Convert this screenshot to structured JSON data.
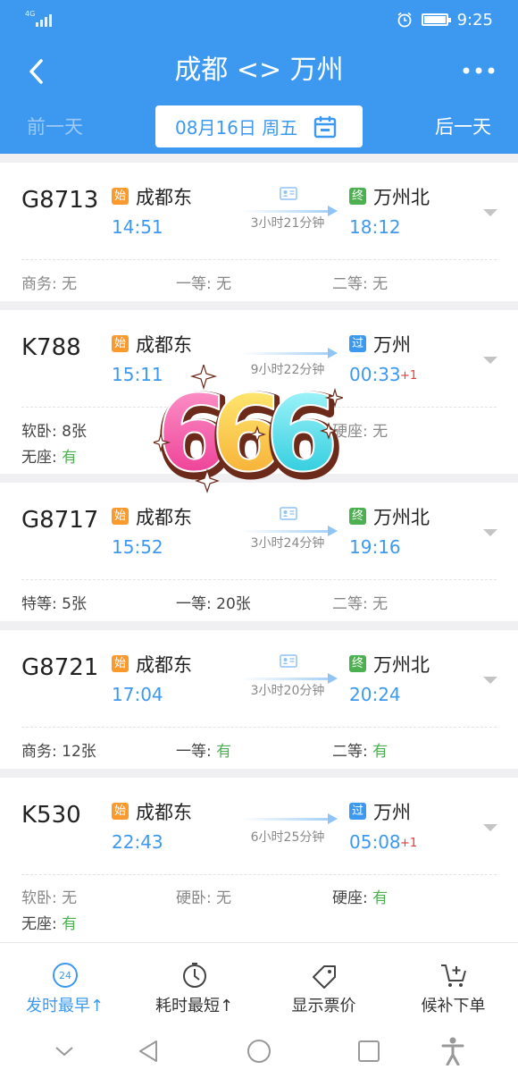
{
  "status_bar": {
    "network": "4G",
    "time": "9:25"
  },
  "header": {
    "title": "成都 <> 万州",
    "prev_day": "前一天",
    "date": "08月16日 周五",
    "next_day": "后一天"
  },
  "trains": [
    {
      "number": "G8713",
      "from_tag": "始",
      "from_station": "成都东",
      "depart": "14:51",
      "to_tag": "终",
      "to_station": "万州北",
      "arrive": "18:12",
      "next_day_mark": "",
      "duration": "3小时21分钟",
      "seats": [
        {
          "label": "商务: ",
          "value": "无"
        },
        {
          "label": "一等: ",
          "value": "无"
        },
        {
          "label": "二等: ",
          "value": "无"
        }
      ]
    },
    {
      "number": "K788",
      "from_tag": "始",
      "from_station": "成都东",
      "depart": "15:11",
      "to_tag": "过",
      "to_station": "万州",
      "arrive": "00:33",
      "next_day_mark": "+1",
      "duration": "9小时22分钟",
      "seats": [
        {
          "label": "软卧: ",
          "value": "8张"
        },
        {
          "label": "硬座: ",
          "value": "无"
        },
        {
          "label": "无座: ",
          "value": "有"
        }
      ]
    },
    {
      "number": "G8717",
      "from_tag": "始",
      "from_station": "成都东",
      "depart": "15:52",
      "to_tag": "终",
      "to_station": "万州北",
      "arrive": "19:16",
      "next_day_mark": "",
      "duration": "3小时24分钟",
      "seats": [
        {
          "label": "特等: ",
          "value": "5张"
        },
        {
          "label": "一等: ",
          "value": "20张"
        },
        {
          "label": "二等: ",
          "value": "无"
        }
      ]
    },
    {
      "number": "G8721",
      "from_tag": "始",
      "from_station": "成都东",
      "depart": "17:04",
      "to_tag": "终",
      "to_station": "万州北",
      "arrive": "20:24",
      "next_day_mark": "",
      "duration": "3小时20分钟",
      "seats": [
        {
          "label": "商务: ",
          "value": "12张"
        },
        {
          "label": "一等: ",
          "value": "有"
        },
        {
          "label": "二等: ",
          "value": "有"
        }
      ]
    },
    {
      "number": "K530",
      "from_tag": "始",
      "from_station": "成都东",
      "depart": "22:43",
      "to_tag": "过",
      "to_station": "万州",
      "arrive": "05:08",
      "next_day_mark": "+1",
      "duration": "6小时25分钟",
      "seats": [
        {
          "label": "软卧: ",
          "value": "无"
        },
        {
          "label": "硬卧: ",
          "value": "无"
        },
        {
          "label": "硬座: ",
          "value": "有"
        },
        {
          "label": "无座: ",
          "value": "有"
        }
      ]
    }
  ],
  "sticker": {
    "text": "666"
  },
  "bottom_tabs": [
    {
      "label": "发时最早↑",
      "icon": "clock-24-icon",
      "active": true,
      "badge": "24"
    },
    {
      "label": "耗时最短↑",
      "icon": "stopwatch-icon",
      "active": false
    },
    {
      "label": "显示票价",
      "icon": "price-tag-icon",
      "active": false
    },
    {
      "label": "候补下单",
      "icon": "cart-plus-icon",
      "active": false
    }
  ],
  "colors": {
    "primary": "#3d99f0",
    "orange_tag": "#fb9a2c",
    "green_tag": "#4caf50",
    "available": "#4caf50",
    "next_day": "#e53935"
  }
}
